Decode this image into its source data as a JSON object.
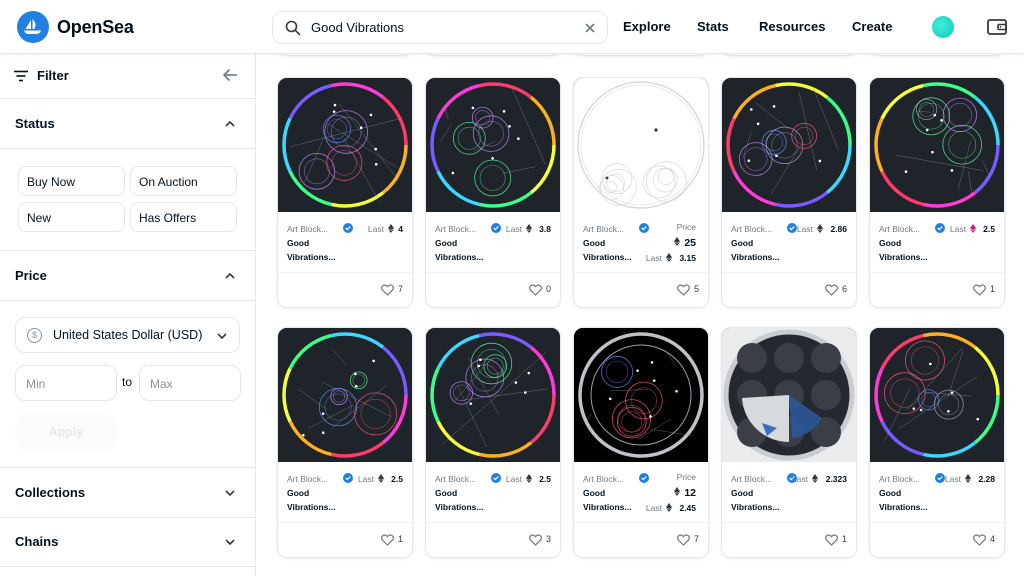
{
  "header": {
    "logo_text": "OpenSea",
    "search_value": "Good Vibrations",
    "nav": [
      "Explore",
      "Stats",
      "Resources",
      "Create"
    ]
  },
  "sidebar": {
    "filter_label": "Filter",
    "status": {
      "title": "Status",
      "options": [
        "Buy Now",
        "On Auction",
        "New",
        "Has Offers"
      ]
    },
    "price": {
      "title": "Price",
      "currency": "United States Dollar (USD)",
      "min_placeholder": "Min",
      "to_label": "to",
      "max_placeholder": "Max",
      "apply_label": "Apply"
    },
    "collections_title": "Collections",
    "chains_title": "Chains"
  },
  "items": [
    {
      "collection": "Art Block...",
      "name_line1": "Good",
      "name_line2": "Vibrations...",
      "last_label": "Last",
      "last_value": "4",
      "price_label": "",
      "price": "",
      "favorites": "7",
      "theme": "dark",
      "eth_color": "#353840"
    },
    {
      "collection": "Art Block...",
      "name_line1": "Good",
      "name_line2": "Vibrations...",
      "last_label": "Last",
      "last_value": "3.8",
      "price_label": "",
      "price": "",
      "favorites": "0",
      "theme": "dark",
      "eth_color": "#353840"
    },
    {
      "collection": "Art Block...",
      "name_line1": "Good",
      "name_line2": "Vibrations...",
      "last_label": "Last",
      "last_value": "3.15",
      "price_label": "Price",
      "price": "25",
      "favorites": "5",
      "theme": "white",
      "eth_color": "#353840"
    },
    {
      "collection": "Art Block...",
      "name_line1": "Good",
      "name_line2": "Vibrations...",
      "last_label": "Last",
      "last_value": "2.86",
      "price_label": "",
      "price": "",
      "favorites": "6",
      "theme": "dark",
      "eth_color": "#353840"
    },
    {
      "collection": "Art Block...",
      "name_line1": "Good",
      "name_line2": "Vibrations...",
      "last_label": "Last",
      "last_value": "2.5",
      "price_label": "",
      "price": "",
      "favorites": "1",
      "theme": "dark",
      "eth_color": "#e2107b"
    },
    {
      "collection": "Art Block...",
      "name_line1": "Good",
      "name_line2": "Vibrations...",
      "last_label": "Last",
      "last_value": "2.5",
      "price_label": "",
      "price": "",
      "favorites": "1",
      "theme": "dark",
      "eth_color": "#353840"
    },
    {
      "collection": "Art Block...",
      "name_line1": "Good",
      "name_line2": "Vibrations...",
      "last_label": "Last",
      "last_value": "2.5",
      "price_label": "",
      "price": "",
      "favorites": "3",
      "theme": "dark",
      "eth_color": "#353840"
    },
    {
      "collection": "Art Block...",
      "name_line1": "Good",
      "name_line2": "Vibrations...",
      "last_label": "Last",
      "last_value": "2.45",
      "price_label": "Price",
      "price": "12",
      "favorites": "7",
      "theme": "black",
      "eth_color": "#353840"
    },
    {
      "collection": "Art Block...",
      "name_line1": "Good",
      "name_line2": "Vibrations...",
      "last_label": "Last",
      "last_value": "2.323",
      "price_label": "",
      "price": "",
      "favorites": "1",
      "theme": "grey",
      "eth_color": "#353840"
    },
    {
      "collection": "Art Block...",
      "name_line1": "Good",
      "name_line2": "Vibrations...",
      "last_label": "Last",
      "last_value": "2.28",
      "price_label": "",
      "price": "",
      "favorites": "4",
      "theme": "dark",
      "eth_color": "#353840"
    }
  ],
  "colors": {
    "accent": "#2081e2",
    "text": "#04111d",
    "muted": "#707a83",
    "border": "#e5e8eb"
  }
}
